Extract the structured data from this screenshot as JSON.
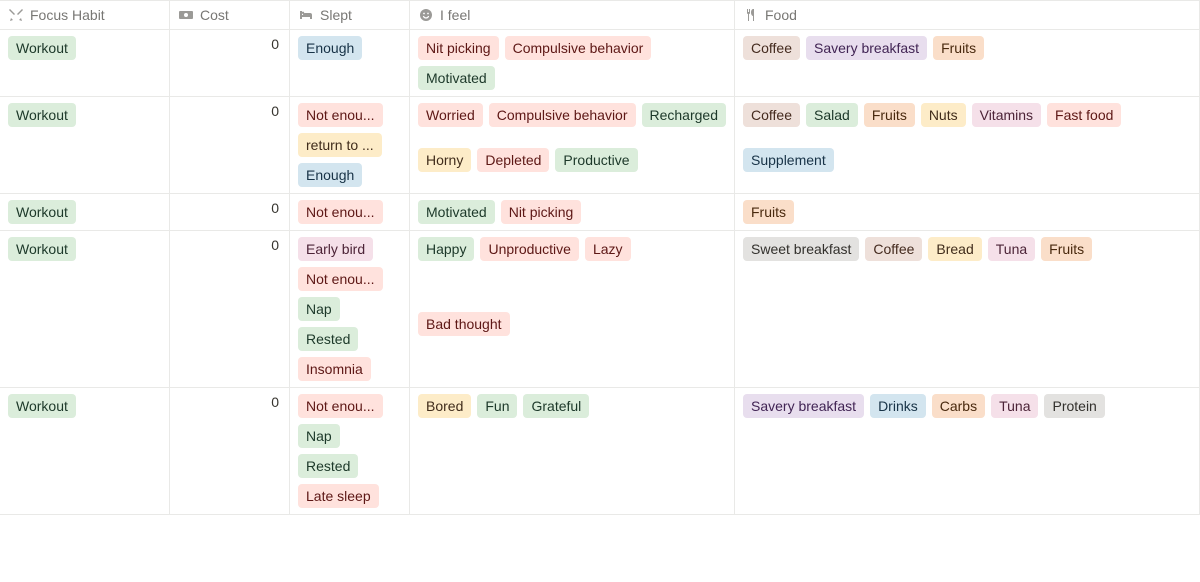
{
  "columns": {
    "focus": "Focus Habit",
    "cost": "Cost",
    "slept": "Slept",
    "feel": "I feel",
    "food": "Food"
  },
  "tag_colors": {
    "Workout": "green",
    "Enough": "blue",
    "Not enou...": "red",
    "return to ...": "yellow",
    "Early bird": "pink",
    "Nap": "green",
    "Rested": "green",
    "Insomnia": "red",
    "Late sleep": "red",
    "Nit picking": "red",
    "Compulsive behavior": "red",
    "Motivated": "green",
    "Worried": "red",
    "Recharged": "green",
    "Horny": "yellow",
    "Depleted": "red",
    "Productive": "green",
    "Happy": "green",
    "Unproductive": "red",
    "Lazy": "red",
    "Bad thought": "red",
    "Bored": "yellow",
    "Fun": "green",
    "Grateful": "green",
    "Coffee": "brown",
    "Savery breakfast": "purple",
    "Fruits": "orange",
    "Salad": "green",
    "Nuts": "yellow",
    "Vitamins": "pink",
    "Fast food": "red",
    "Supplement": "blue",
    "Sweet breakfast": "gray",
    "Bread": "yellow",
    "Tuna": "pink",
    "Drinks": "blue",
    "Carbs": "orange",
    "Protein": "gray"
  },
  "rows": [
    {
      "focus": [
        "Workout"
      ],
      "cost": "0",
      "slept": [
        "Enough"
      ],
      "feel": [
        "Nit picking",
        "Compulsive behavior",
        "Motivated"
      ],
      "food": [
        "Coffee",
        "Savery breakfast",
        "Fruits"
      ]
    },
    {
      "focus": [
        "Workout"
      ],
      "cost": "0",
      "slept": [
        "Not enou...",
        "return to ...",
        "Enough"
      ],
      "feel": [
        "Worried",
        "Compulsive behavior",
        "Recharged",
        "Horny",
        "Depleted",
        "Productive"
      ],
      "food": [
        "Coffee",
        "Salad",
        "Fruits",
        "Nuts",
        "Vitamins",
        "Fast food",
        "Supplement"
      ]
    },
    {
      "focus": [
        "Workout"
      ],
      "cost": "0",
      "slept": [
        "Not enou..."
      ],
      "feel": [
        "Motivated",
        "Nit picking"
      ],
      "food": [
        "Fruits"
      ]
    },
    {
      "focus": [
        "Workout"
      ],
      "cost": "0",
      "slept": [
        "Early bird",
        "Not enou...",
        "Nap",
        "Rested",
        "Insomnia"
      ],
      "feel": [
        "Happy",
        "Unproductive",
        "Lazy",
        "Bad thought"
      ],
      "food": [
        "Sweet breakfast",
        "Coffee",
        "Bread",
        "Tuna",
        "Fruits"
      ]
    },
    {
      "focus": [
        "Workout"
      ],
      "cost": "0",
      "slept": [
        "Not enou...",
        "Nap",
        "Rested",
        "Late sleep"
      ],
      "feel": [
        "Bored",
        "Fun",
        "Grateful"
      ],
      "food": [
        "Savery breakfast",
        "Drinks",
        "Carbs",
        "Tuna",
        "Protein"
      ]
    }
  ]
}
